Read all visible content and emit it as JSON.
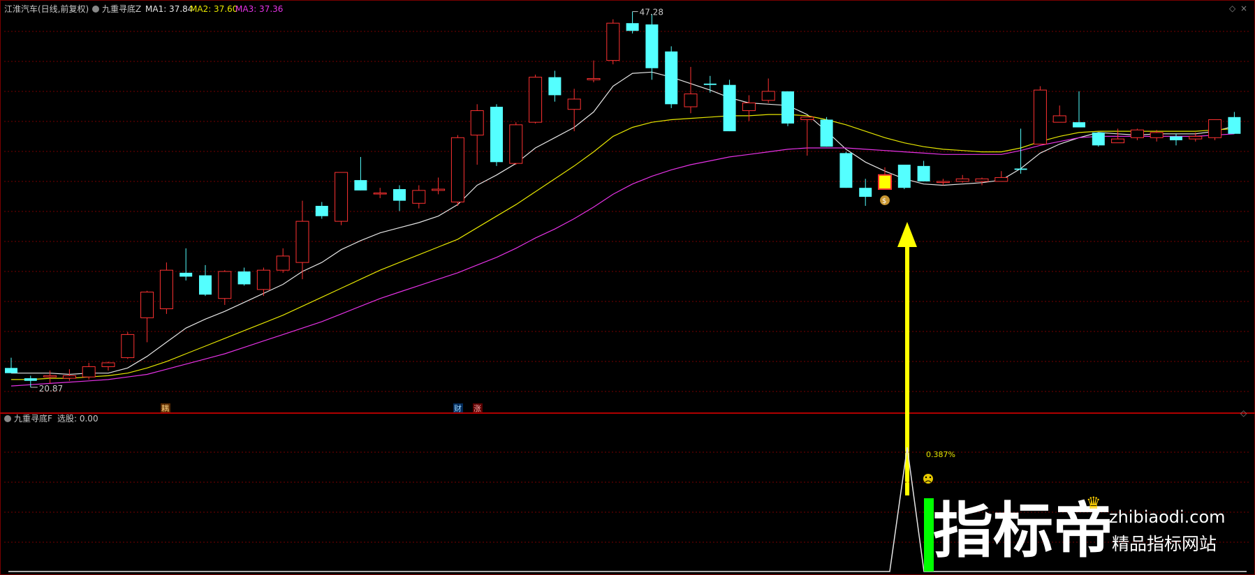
{
  "main_panel": {
    "title": "江淮汽车(日线,前复权)",
    "indicator_name": "九重寻底Z",
    "ma1_label": "MA1: 37.84",
    "ma2_label": "MA2: 37.60",
    "ma3_label": "MA3: 37.36",
    "high_label": "47.28",
    "low_label": "20.87",
    "markers": [
      "耦",
      "财",
      "涨"
    ],
    "signal_icon": "money-bag-icon"
  },
  "sub_panel": {
    "indicator_name": "九重寻底F",
    "select_label": "选股: 0.00",
    "annotation": "0.387%",
    "face_icon": "sad-face-icon"
  },
  "watermark": {
    "big": "指标帝",
    "url": "zhibiaodi.com",
    "sub": "精品指标网站"
  },
  "colors": {
    "up": "#ff3232",
    "down": "#54ffff",
    "ma1": "#e6e6e6",
    "ma2": "#e6e600",
    "ma3": "#e632e6",
    "grid": "#7a0000",
    "arrow": "#ffff00",
    "signal_bar": "#00ff00"
  },
  "chart_data": {
    "type": "candlestick",
    "title": "江淮汽车(日线,前复权)",
    "ohlc": [
      [
        22.4,
        23.2,
        22.0,
        22.0
      ],
      [
        21.6,
        21.8,
        20.9,
        21.4
      ],
      [
        21.7,
        22.2,
        21.2,
        21.8
      ],
      [
        21.6,
        22.3,
        21.4,
        21.8
      ],
      [
        21.7,
        22.8,
        21.5,
        22.5
      ],
      [
        22.5,
        22.9,
        22.2,
        22.8
      ],
      [
        23.2,
        25.2,
        23.1,
        25.0
      ],
      [
        26.3,
        28.4,
        24.4,
        28.3
      ],
      [
        27.0,
        30.6,
        26.6,
        30.0
      ],
      [
        29.8,
        31.7,
        29.2,
        29.5
      ],
      [
        29.6,
        30.4,
        28.0,
        28.1
      ],
      [
        27.8,
        30.0,
        27.3,
        29.9
      ],
      [
        29.9,
        30.2,
        28.8,
        28.9
      ],
      [
        28.5,
        30.2,
        28.0,
        30.0
      ],
      [
        30.0,
        31.7,
        29.8,
        31.1
      ],
      [
        30.6,
        35.4,
        29.3,
        33.8
      ],
      [
        35.0,
        35.3,
        34.0,
        34.2
      ],
      [
        33.8,
        37.6,
        33.5,
        37.6
      ],
      [
        37.0,
        38.8,
        36.2,
        36.2
      ],
      [
        36.0,
        36.4,
        35.6,
        36.0
      ],
      [
        36.3,
        36.6,
        34.6,
        35.4
      ],
      [
        35.2,
        36.6,
        34.8,
        36.2
      ],
      [
        36.2,
        37.2,
        35.9,
        36.3
      ],
      [
        35.3,
        40.5,
        35.0,
        40.3
      ],
      [
        40.5,
        42.9,
        38.2,
        42.4
      ],
      [
        42.7,
        42.9,
        38.1,
        38.4
      ],
      [
        38.3,
        41.5,
        38.2,
        41.3
      ],
      [
        41.5,
        45.2,
        41.4,
        45.0
      ],
      [
        45.0,
        45.5,
        43.1,
        43.6
      ],
      [
        42.5,
        44.1,
        40.8,
        43.3
      ],
      [
        44.8,
        46.3,
        44.6,
        44.9
      ],
      [
        46.3,
        49.5,
        46.0,
        49.2
      ],
      [
        49.2,
        50.1,
        48.4,
        48.6
      ],
      [
        49.1,
        49.9,
        44.8,
        45.7
      ],
      [
        47.0,
        47.4,
        42.6,
        42.9
      ],
      [
        42.7,
        45.8,
        42.2,
        43.7
      ],
      [
        44.5,
        45.1,
        43.8,
        44.4
      ],
      [
        44.4,
        44.8,
        40.8,
        40.8
      ],
      [
        42.4,
        43.6,
        41.6,
        43.0
      ],
      [
        43.2,
        44.9,
        43.0,
        43.9
      ],
      [
        43.9,
        43.9,
        41.2,
        41.4
      ],
      [
        41.7,
        41.7,
        38.9,
        41.9
      ],
      [
        41.7,
        41.9,
        39.6,
        39.6
      ],
      [
        39.1,
        39.2,
        36.4,
        36.4
      ],
      [
        36.4,
        37.1,
        35.0,
        35.7
      ],
      [
        36.3,
        38.0,
        36.3,
        37.4
      ],
      [
        38.2,
        38.2,
        36.3,
        36.4
      ],
      [
        38.1,
        38.5,
        36.9,
        36.9
      ],
      [
        36.9,
        37.1,
        36.6,
        36.9
      ],
      [
        36.9,
        37.4,
        36.8,
        37.1
      ],
      [
        36.9,
        37.2,
        36.6,
        37.1
      ],
      [
        36.9,
        37.7,
        36.9,
        37.2
      ],
      [
        37.9,
        41.0,
        37.5,
        37.8
      ],
      [
        39.8,
        44.3,
        39.8,
        44.0
      ],
      [
        41.5,
        42.8,
        41.5,
        42.0
      ],
      [
        41.5,
        43.9,
        41.1,
        41.1
      ],
      [
        40.7,
        40.7,
        39.6,
        39.7
      ],
      [
        39.9,
        41.0,
        39.9,
        40.2
      ],
      [
        40.3,
        41.0,
        40.1,
        40.9
      ],
      [
        40.3,
        40.9,
        40.0,
        40.7
      ],
      [
        40.4,
        40.6,
        39.7,
        40.1
      ],
      [
        40.2,
        40.7,
        40.0,
        40.4
      ],
      [
        40.3,
        41.7,
        40.1,
        41.7
      ],
      [
        41.9,
        42.3,
        40.6,
        40.6
      ]
    ],
    "series": [
      {
        "name": "MA1",
        "values": [
          22.0,
          22.0,
          22.0,
          21.9,
          22.0,
          22.0,
          22.4,
          23.3,
          24.4,
          25.5,
          26.2,
          26.8,
          27.5,
          28.2,
          28.9,
          29.9,
          30.6,
          31.6,
          32.3,
          32.9,
          33.3,
          33.7,
          34.2,
          35.1,
          36.6,
          37.4,
          38.3,
          39.5,
          40.3,
          41.1,
          42.3,
          44.3,
          45.3,
          45.4,
          45.0,
          44.5,
          44.0,
          43.4,
          43.0,
          42.9,
          42.8,
          42.1,
          40.8,
          39.4,
          38.4,
          37.7,
          37.1,
          36.7,
          36.6,
          36.7,
          36.8,
          37.0,
          37.9,
          39.1,
          39.8,
          40.3,
          40.7,
          40.6,
          40.5,
          40.6,
          40.6,
          40.6,
          40.8,
          41.2
        ]
      },
      {
        "name": "MA2",
        "values": [
          21.5,
          21.5,
          21.6,
          21.6,
          21.7,
          21.8,
          22.0,
          22.4,
          22.9,
          23.5,
          24.1,
          24.7,
          25.3,
          25.9,
          26.5,
          27.2,
          27.9,
          28.6,
          29.3,
          30.0,
          30.6,
          31.2,
          31.8,
          32.4,
          33.3,
          34.2,
          35.1,
          36.1,
          37.1,
          38.1,
          39.2,
          40.4,
          41.1,
          41.5,
          41.7,
          41.8,
          41.9,
          42.0,
          42.0,
          42.1,
          42.1,
          42.0,
          41.7,
          41.3,
          40.8,
          40.3,
          39.9,
          39.6,
          39.4,
          39.3,
          39.2,
          39.2,
          39.5,
          40.0,
          40.4,
          40.7,
          40.8,
          40.8,
          40.8,
          40.8,
          40.8,
          40.8,
          40.9,
          41.0
        ]
      },
      {
        "name": "MA3",
        "values": [
          21.0,
          21.1,
          21.2,
          21.3,
          21.4,
          21.5,
          21.7,
          21.9,
          22.3,
          22.7,
          23.1,
          23.5,
          24.0,
          24.5,
          25.0,
          25.5,
          26.0,
          26.6,
          27.2,
          27.8,
          28.3,
          28.8,
          29.3,
          29.8,
          30.4,
          31.0,
          31.7,
          32.5,
          33.2,
          34.0,
          34.9,
          35.9,
          36.7,
          37.3,
          37.8,
          38.2,
          38.5,
          38.8,
          39.0,
          39.2,
          39.4,
          39.5,
          39.5,
          39.5,
          39.4,
          39.3,
          39.2,
          39.1,
          39.0,
          39.0,
          39.0,
          39.0,
          39.3,
          39.7,
          40.0,
          40.3,
          40.4,
          40.4,
          40.4,
          40.4,
          40.4,
          40.4,
          40.5,
          40.6
        ]
      }
    ],
    "signal_index": 45,
    "subchart": {
      "values_on_signal": 1,
      "annotation": "0.387%"
    },
    "ylim": [
      19,
      51
    ],
    "grid": true
  }
}
